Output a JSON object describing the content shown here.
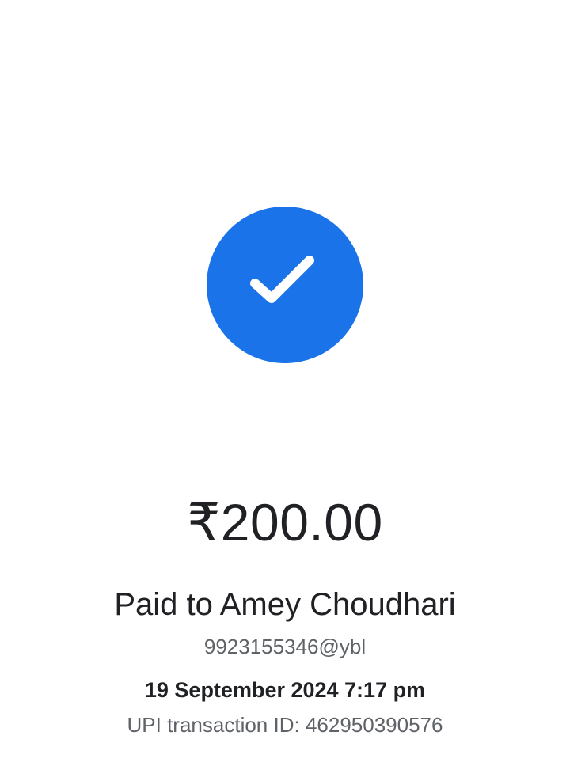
{
  "status": {
    "icon": "check-icon",
    "badge_color": "#1a73e8"
  },
  "payment": {
    "amount": "₹200.00",
    "recipient_line": "Paid to Amey Choudhari",
    "recipient_upi_id": "9923155346@ybl",
    "datetime": "19 September 2024 7:17 pm",
    "transaction_label": "UPI transaction ID:",
    "transaction_id": "462950390576"
  }
}
